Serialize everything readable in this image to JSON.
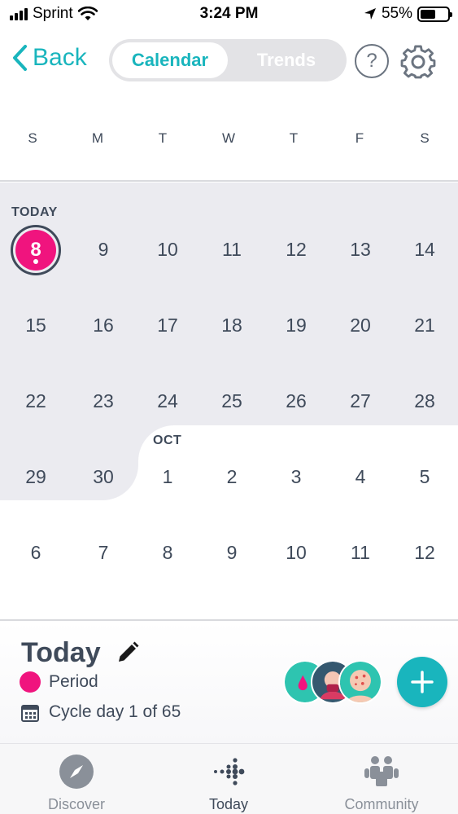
{
  "status_bar": {
    "carrier": "Sprint",
    "time": "3:24 PM",
    "battery_percent": "55%",
    "battery_level": 0.55
  },
  "nav": {
    "back_label": "Back",
    "tabs": [
      {
        "label": "Calendar",
        "selected": true
      },
      {
        "label": "Trends",
        "selected": false
      }
    ],
    "help_glyph": "?"
  },
  "weekdays": [
    "S",
    "M",
    "T",
    "W",
    "T",
    "F",
    "S"
  ],
  "calendar": {
    "today_label": "TODAY",
    "month_label": "OCT",
    "today_value": "8",
    "weeks": [
      [
        "8",
        "9",
        "10",
        "11",
        "12",
        "13",
        "14"
      ],
      [
        "15",
        "16",
        "17",
        "18",
        "19",
        "20",
        "21"
      ],
      [
        "22",
        "23",
        "24",
        "25",
        "26",
        "27",
        "28"
      ],
      [
        "29",
        "30",
        "1",
        "2",
        "3",
        "4",
        "5"
      ],
      [
        "6",
        "7",
        "8",
        "9",
        "10",
        "11",
        "12"
      ]
    ]
  },
  "summary": {
    "title": "Today",
    "period_label": "Period",
    "cycle_label": "Cycle day 1 of 65"
  },
  "tabbar": {
    "items": [
      {
        "label": "Discover",
        "icon": "compass-icon",
        "active": false
      },
      {
        "label": "Today",
        "icon": "fitbit-dots-icon",
        "active": true
      },
      {
        "label": "Community",
        "icon": "community-icon",
        "active": false
      }
    ]
  },
  "colors": {
    "accent": "#19b5bd",
    "period": "#f0147e",
    "text": "#3f4a5a",
    "shade": "#ebebf0"
  }
}
